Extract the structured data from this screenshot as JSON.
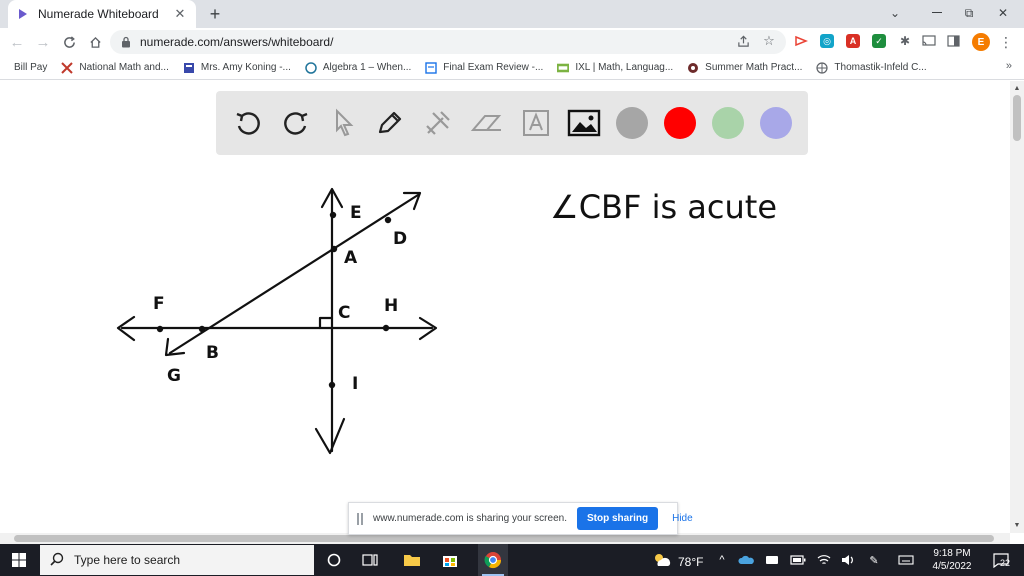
{
  "browser": {
    "tab_title": "Numerade Whiteboard",
    "tab_close": "✕",
    "new_tab": "+",
    "window_minimize": "⌄",
    "window_restore": "⧉",
    "window_close": "✕",
    "url": "numerade.com/answers/whiteboard/",
    "profile_initial": "E",
    "menu": "⋮"
  },
  "bookmarks": [
    {
      "label": "Bill Pay",
      "icon": "bookmark-icon"
    },
    {
      "label": "National Math and...",
      "icon": "nm-icon"
    },
    {
      "label": "Mrs. Amy Koning -...",
      "icon": "doc-icon"
    },
    {
      "label": "Algebra 1 – When...",
      "icon": "wordpress-icon"
    },
    {
      "label": "Final Exam Review -...",
      "icon": "form-icon"
    },
    {
      "label": "IXL | Math, Languag...",
      "icon": "ixl-icon"
    },
    {
      "label": "Summer Math Pract...",
      "icon": "circle-icon"
    },
    {
      "label": "Thomastik-Infeld C...",
      "icon": "globe-icon"
    }
  ],
  "bookmarks_more": "»",
  "whiteboard": {
    "colors": {
      "gray": "#a6a6a6",
      "red": "#ff0000",
      "green": "#a9d3a9",
      "purple": "#a8a8e8"
    },
    "labels": {
      "E": "E",
      "D": "D",
      "A": "A",
      "F": "F",
      "C": "C",
      "H": "H",
      "B": "B",
      "G": "G",
      "I": "I"
    },
    "statement": "∠CBF is acute"
  },
  "share": {
    "text": "www.numerade.com is sharing your screen.",
    "stop": "Stop sharing",
    "hide": "Hide"
  },
  "taskbar": {
    "search_placeholder": "Type here to search",
    "temperature": "78°F",
    "time": "9:18 PM",
    "date": "4/5/2022",
    "notifications": "22"
  }
}
